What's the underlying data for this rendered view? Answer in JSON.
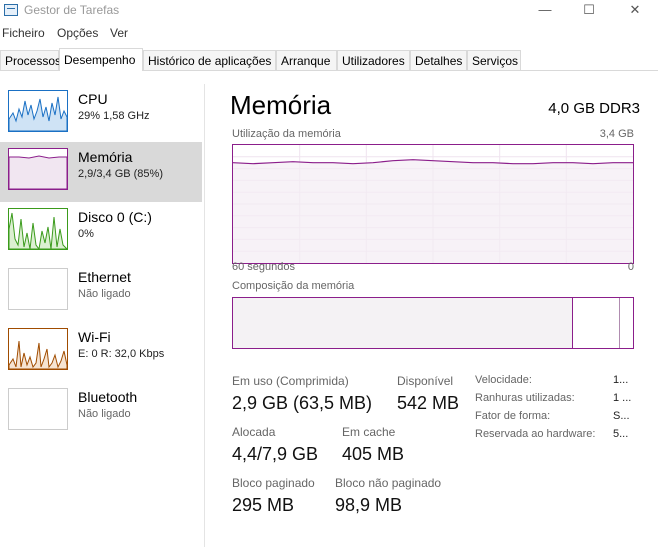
{
  "window": {
    "title": "Gestor de Tarefas",
    "minimize": "—",
    "maximize": "☐",
    "close": "✕"
  },
  "menu": [
    "Ficheiro",
    "Opções",
    "Ver"
  ],
  "tabs": [
    "Processos",
    "Desempenho",
    "Histórico de aplicações",
    "Arranque",
    "Utilizadores",
    "Detalhes",
    "Serviços"
  ],
  "sidebar": [
    {
      "name": "CPU",
      "sub": "29%  1,58 GHz",
      "color": "#1a70c4"
    },
    {
      "name": "Memória",
      "sub": "2,9/3,4 GB (85%)",
      "color": "#8b1e8b"
    },
    {
      "name": "Disco 0 (C:)",
      "sub": "0%",
      "color": "#3b9b1c"
    },
    {
      "name": "Ethernet",
      "sub": "Não ligado",
      "color": "#a04c00"
    },
    {
      "name": "Wi-Fi",
      "sub": "E: 0  R: 32,0 Kbps",
      "color": "#a04c00"
    },
    {
      "name": "Bluetooth",
      "sub": "Não ligado",
      "color": "#a04c00"
    }
  ],
  "main": {
    "title": "Memória",
    "spec": "4,0 GB DDR3",
    "graph_label": "Utilização da memória",
    "graph_max": "3,4 GB",
    "graph_xleft": "60 segundos",
    "graph_xright": "0",
    "composition_label": "Composição da memória",
    "usage_fraction": 0.85
  },
  "stats": {
    "in_use_label": "Em uso (Comprimida)",
    "in_use_value": "2,9 GB (63,5 MB)",
    "available_label": "Disponível",
    "available_value": "542 MB",
    "committed_label": "Alocada",
    "committed_value": "4,4/7,9 GB",
    "cached_label": "Em cache",
    "cached_value": "405 MB",
    "paged_label": "Bloco paginado",
    "paged_value": "295 MB",
    "nonpaged_label": "Bloco não paginado",
    "nonpaged_value": "98,9 MB"
  },
  "info": {
    "speed_label": "Velocidade:",
    "speed_value": "1...",
    "slots_label": "Ranhuras utilizadas:",
    "slots_value": "1 ...",
    "form_label": "Fator de forma:",
    "form_value": "S...",
    "reserved_label": "Reservada ao hardware:",
    "reserved_value": "5..."
  }
}
